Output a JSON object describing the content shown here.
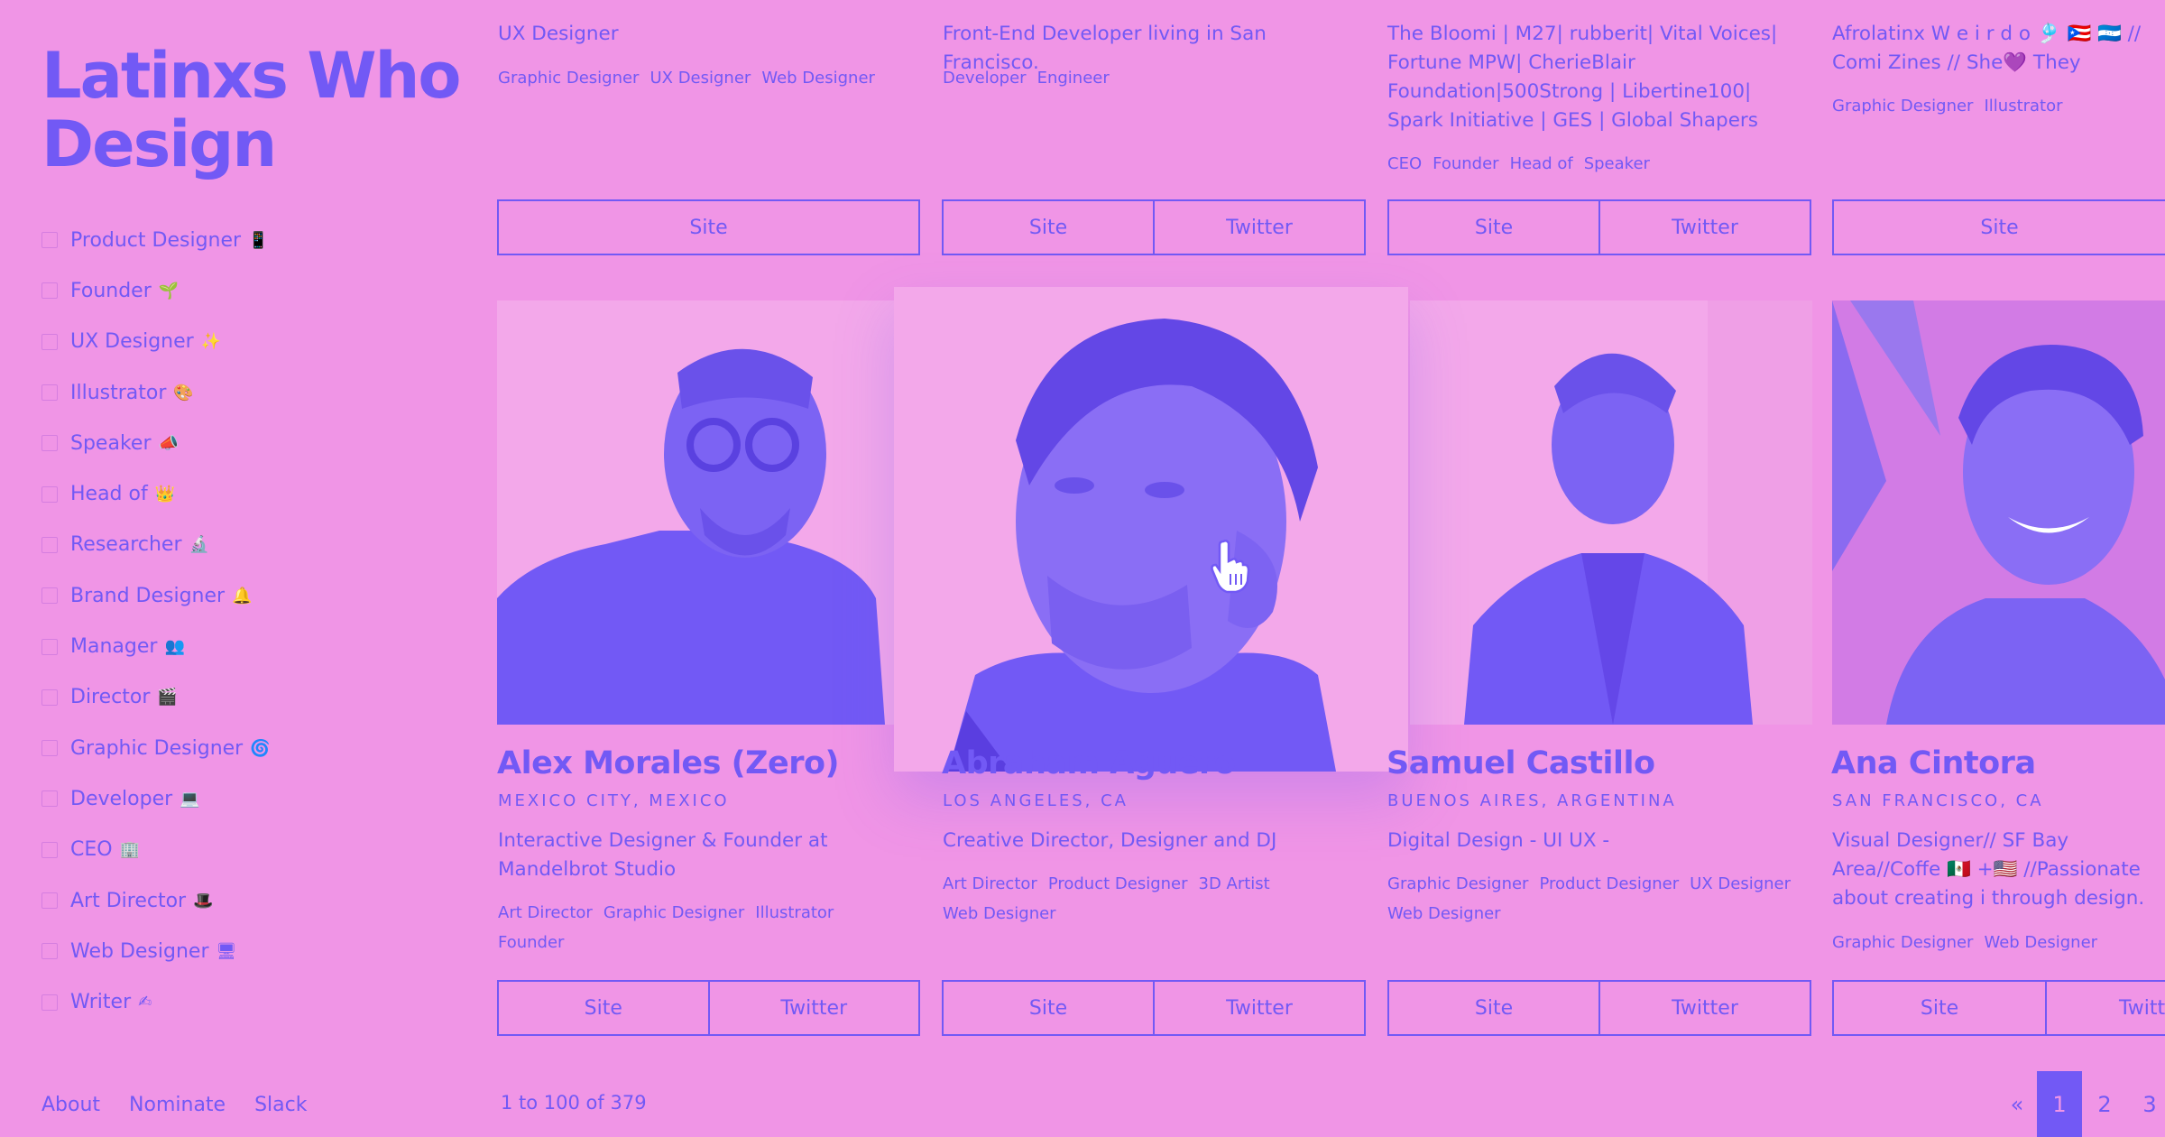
{
  "sidebar": {
    "logo": "Latinxs Who Design",
    "filters": [
      {
        "label": "Product Designer",
        "emoji": "📱"
      },
      {
        "label": "Founder",
        "emoji": "🌱"
      },
      {
        "label": "UX Designer",
        "emoji": "✨"
      },
      {
        "label": "Illustrator",
        "emoji": "🎨"
      },
      {
        "label": "Speaker",
        "emoji": "📣"
      },
      {
        "label": "Head of",
        "emoji": "👑"
      },
      {
        "label": "Researcher",
        "emoji": "🔬"
      },
      {
        "label": "Brand Designer",
        "emoji": "🔔"
      },
      {
        "label": "Manager",
        "emoji": "👥"
      },
      {
        "label": "Director",
        "emoji": "🎬"
      },
      {
        "label": "Graphic Designer",
        "emoji": "🌀"
      },
      {
        "label": "Developer",
        "emoji": "💻"
      },
      {
        "label": "CEO",
        "emoji": "🏢"
      },
      {
        "label": "Art Director",
        "emoji": "🎩"
      },
      {
        "label": "Web Designer",
        "emoji": "🖥"
      },
      {
        "label": "Writer",
        "emoji": "✍"
      }
    ],
    "footer": [
      "About",
      "Nominate",
      "Slack"
    ]
  },
  "top_cards": [
    {
      "desc": "UX Designer",
      "tags": [
        "Graphic Designer",
        "UX Designer",
        "Web Designer"
      ],
      "buttons": [
        "Site"
      ]
    },
    {
      "desc": "Front-End Developer living in San Francisco.",
      "tags": [
        "Developer",
        "Engineer"
      ],
      "buttons": [
        "Site",
        "Twitter"
      ]
    },
    {
      "desc": "The Bloomi | M27| rubberit| Vital Voices| Fortune MPW| CherieBlair Foundation|500Strong | Libertine100| Spark Initiative | GES | Global Shapers",
      "tags": [
        "CEO",
        "Founder",
        "Head of",
        "Speaker"
      ],
      "buttons": [
        "Site",
        "Twitter"
      ]
    },
    {
      "desc": "Afrolatinx W e i r d o 🎐 🇵🇷 🇭🇳 // Comi Zines // She💜 They",
      "tags": [
        "Graphic Designer",
        "Illustrator"
      ],
      "buttons": [
        "Site"
      ]
    }
  ],
  "profiles": [
    {
      "name": "Alex Morales (Zero)",
      "location": "MEXICO CITY, MEXICO",
      "bio": "Interactive Designer & Founder at Mandelbrot Studio",
      "tags": [
        "Art Director",
        "Graphic Designer",
        "Illustrator",
        "Founder"
      ],
      "buttons": [
        "Site",
        "Twitter"
      ]
    },
    {
      "name": "Abraham Agüero",
      "location": "LOS ANGELES, CA",
      "bio": "Creative Director, Designer and DJ",
      "tags": [
        "Art Director",
        "Product Designer",
        "3D Artist",
        "Web Designer"
      ],
      "buttons": [
        "Site",
        "Twitter"
      ]
    },
    {
      "name": "Samuel Castillo",
      "location": "BUENOS AIRES, ARGENTINA",
      "bio": "Digital Design - UI UX -",
      "tags": [
        "Graphic Designer",
        "Product Designer",
        "UX Designer",
        "Web Designer"
      ],
      "buttons": [
        "Site",
        "Twitter"
      ]
    },
    {
      "name": "Ana Cintora",
      "location": "SAN FRANCISCO, CA",
      "bio": "Visual Designer// SF Bay Area//Coffe 🇲🇽 +🇺🇸 //Passionate about creating i through design.",
      "tags": [
        "Graphic Designer",
        "Web Designer"
      ],
      "buttons": [
        "Site",
        "Twitter"
      ]
    }
  ],
  "pagination": {
    "summary": "1 to 100 of 379",
    "prev": "«",
    "pages": [
      "1",
      "2",
      "3"
    ]
  },
  "colors": {
    "background": "#f095e6",
    "accent": "#7259f5"
  }
}
